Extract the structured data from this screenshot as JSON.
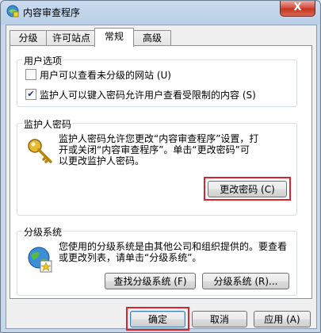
{
  "window": {
    "title": "内容审查程序",
    "close_glyph": "X"
  },
  "tabs": [
    {
      "label": "分级",
      "active": false
    },
    {
      "label": "许可站点",
      "active": false
    },
    {
      "label": "常规",
      "active": true
    },
    {
      "label": "高级",
      "active": false
    }
  ],
  "user_options": {
    "label": "用户选项",
    "items": [
      {
        "label": "用户可以查看未分级的网站 (U)",
        "checked": false
      },
      {
        "label": "监护人可以键入密码允许用户查看受限制的内容 (S)",
        "checked": true
      }
    ]
  },
  "supervisor_password": {
    "label": "监护人密码",
    "description": "监护人密码允许您更改“内容审查程序”设置，打\n开或关闭“内容审查程序”。单击“更改密码”可\n以更改监护人密码。",
    "change_button": "更改密码 (C)"
  },
  "rating_systems": {
    "label": "分级系统",
    "description": "您使用的分级系统是由其他公司和组织提供的。要查看\n或更改列表，请单击“分级系统”。",
    "find_button": "查找分级系统 (F)",
    "systems_button": "分级系统 (R)..."
  },
  "dialog_buttons": {
    "ok": "确定",
    "cancel": "取消",
    "apply": "应用 (A)"
  },
  "colors": {
    "highlight": "#d9232e",
    "tab_active_bg": "#ffffff",
    "window_frame": "#b9cfe7"
  },
  "icons": [
    "ratings-app-icon",
    "key-icon",
    "globe-certificate-icon",
    "checkmark-icon"
  ]
}
